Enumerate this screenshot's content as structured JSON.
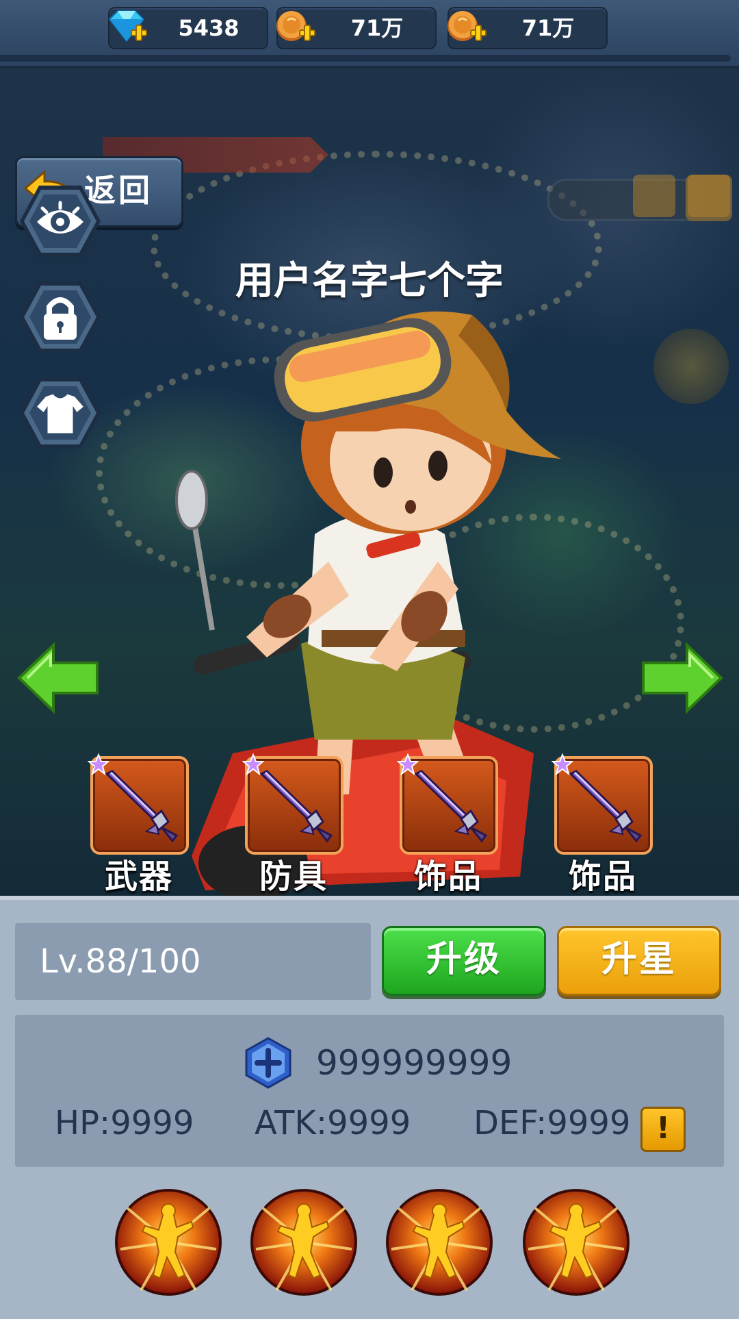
{
  "currency": [
    {
      "icon": "diamond-plus-icon",
      "value": "5438"
    },
    {
      "icon": "coin-plus-icon",
      "value": "71万"
    },
    {
      "icon": "coin-plus-icon",
      "value": "71万"
    }
  ],
  "back_button": {
    "label": "返回",
    "icon": "back-arrow-icon"
  },
  "side_buttons": [
    {
      "icon": "eye-icon"
    },
    {
      "icon": "lock-icon"
    },
    {
      "icon": "tshirt-icon"
    }
  ],
  "character": {
    "name": "用户名字七个字"
  },
  "nav": {
    "prev_icon": "left-arrow-icon",
    "next_icon": "right-arrow-icon"
  },
  "equipment": [
    {
      "label": "武器",
      "icon": "sword-icon"
    },
    {
      "label": "防具",
      "icon": "sword-icon"
    },
    {
      "label": "饰品",
      "icon": "sword-icon"
    },
    {
      "label": "饰品",
      "icon": "sword-icon"
    }
  ],
  "level": {
    "text": "Lv.88/100"
  },
  "actions": {
    "upgrade_label": "升级",
    "star_up_label": "升星"
  },
  "power": {
    "value": "999999999",
    "icon": "power-gem-icon"
  },
  "stats": {
    "hp": "HP:9999",
    "atk": "ATK:9999",
    "def": "DEF:9999",
    "info_label": "!"
  },
  "skills": [
    {
      "icon": "skill-burst-icon"
    },
    {
      "icon": "skill-burst-icon"
    },
    {
      "icon": "skill-burst-icon"
    },
    {
      "icon": "skill-burst-icon"
    }
  ],
  "colors": {
    "panel_bg": "#a7b6c7",
    "upgrade_green": "#2fbf2c",
    "star_gold": "#f5b51a",
    "slot_orange": "#c24a14",
    "stat_text": "#24344f"
  }
}
